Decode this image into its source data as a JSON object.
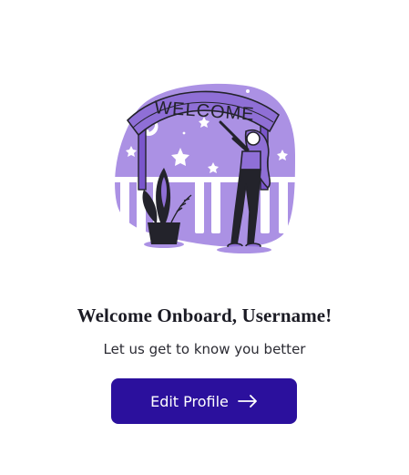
{
  "illustration": {
    "banner_text": "WELCOME",
    "colors": {
      "accent": "#8f6fd6",
      "accent_light": "#ab91e4",
      "dark": "#23232b"
    }
  },
  "welcome": {
    "title": "Welcome Onboard, Username!",
    "subtitle": "Let us get to know you better"
  },
  "cta": {
    "label": "Edit Profile",
    "icon": "arrow-right-icon",
    "color": "#2b109d"
  }
}
